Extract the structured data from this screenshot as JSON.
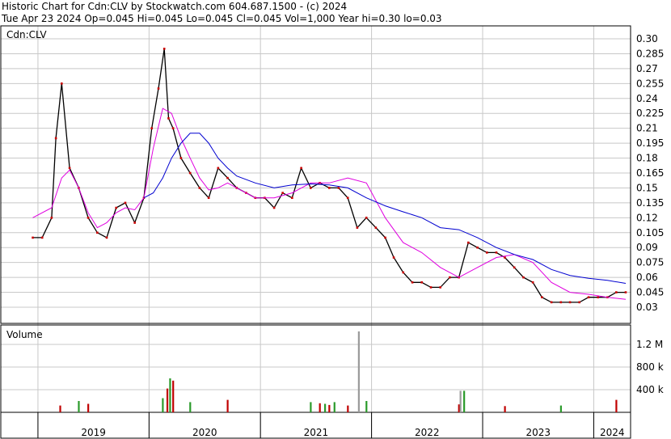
{
  "header": {
    "line1": "Historic Chart for Cdn:CLV by Stockwatch.com 604.687.1500 - (c) 2024",
    "line2": "Tue Apr 23 2024  Op=0.045  Hi=0.045  Lo=0.045  Cl=0.045  Vol=1,000  Year hi=0.30  lo=0.03"
  },
  "chart_data": {
    "type": "line",
    "symbol_label": "Cdn:CLV",
    "volume_label": "Volume",
    "price_ticks": [
      "0.30",
      "0.285",
      "0.27",
      "0.255",
      "0.24",
      "0.225",
      "0.21",
      "0.195",
      "0.18",
      "0.165",
      "0.15",
      "0.135",
      "0.12",
      "0.105",
      "0.09",
      "0.075",
      "0.06",
      "0.045",
      "0.03"
    ],
    "volume_ticks": [
      "1.2 M",
      "800 k",
      "400 k"
    ],
    "year_labels": [
      "2019",
      "2020",
      "2021",
      "2022",
      "2023",
      "2024"
    ],
    "price_range": [
      0.03,
      0.3
    ],
    "volume_range": [
      0,
      1400000
    ],
    "grid": true,
    "series": [
      {
        "name": "price",
        "x": [
          "2018-12-15",
          "2019-01-15",
          "2019-02-15",
          "2019-03-01",
          "2019-03-20",
          "2019-04-15",
          "2019-05-15",
          "2019-06-15",
          "2019-07-15",
          "2019-08-15",
          "2019-09-15",
          "2019-10-15",
          "2019-11-15",
          "2019-12-15",
          "2020-01-10",
          "2020-02-01",
          "2020-02-20",
          "2020-03-05",
          "2020-03-20",
          "2020-04-15",
          "2020-05-15",
          "2020-06-15",
          "2020-07-15",
          "2020-08-15",
          "2020-09-15",
          "2020-10-15",
          "2020-11-15",
          "2020-12-15",
          "2021-01-15",
          "2021-02-15",
          "2021-03-15",
          "2021-04-15",
          "2021-05-15",
          "2021-06-15",
          "2021-07-15",
          "2021-08-15",
          "2021-09-15",
          "2021-10-15",
          "2021-11-15",
          "2021-12-15",
          "2022-01-15",
          "2022-02-15",
          "2022-03-15",
          "2022-04-15",
          "2022-05-15",
          "2022-06-15",
          "2022-07-15",
          "2022-08-15",
          "2022-09-15",
          "2022-10-15",
          "2022-11-15",
          "2022-12-15",
          "2023-01-15",
          "2023-02-15",
          "2023-03-15",
          "2023-04-15",
          "2023-05-15",
          "2023-06-15",
          "2023-07-15",
          "2023-08-15",
          "2023-09-15",
          "2023-10-15",
          "2023-11-15",
          "2023-12-15",
          "2024-01-15",
          "2024-02-15",
          "2024-03-15",
          "2024-04-15"
        ],
        "values": [
          0.1,
          0.1,
          0.12,
          0.2,
          0.255,
          0.17,
          0.15,
          0.12,
          0.105,
          0.1,
          0.13,
          0.135,
          0.115,
          0.14,
          0.21,
          0.25,
          0.29,
          0.22,
          0.21,
          0.18,
          0.165,
          0.15,
          0.14,
          0.17,
          0.16,
          0.15,
          0.145,
          0.14,
          0.14,
          0.13,
          0.145,
          0.14,
          0.17,
          0.15,
          0.155,
          0.15,
          0.15,
          0.14,
          0.11,
          0.12,
          0.11,
          0.1,
          0.08,
          0.065,
          0.055,
          0.055,
          0.05,
          0.05,
          0.06,
          0.06,
          0.095,
          0.09,
          0.085,
          0.085,
          0.08,
          0.07,
          0.06,
          0.055,
          0.04,
          0.035,
          0.035,
          0.035,
          0.035,
          0.04,
          0.04,
          0.04,
          0.045,
          0.045
        ]
      },
      {
        "name": "ma-short",
        "x": [
          "2018-12-15",
          "2019-02-15",
          "2019-03-20",
          "2019-04-15",
          "2019-05-15",
          "2019-06-15",
          "2019-07-15",
          "2019-08-15",
          "2019-09-15",
          "2019-10-15",
          "2019-11-15",
          "2019-12-15",
          "2020-01-15",
          "2020-02-15",
          "2020-03-15",
          "2020-04-15",
          "2020-05-15",
          "2020-06-15",
          "2020-07-15",
          "2020-08-15",
          "2020-09-15",
          "2020-10-15",
          "2020-12-15",
          "2021-02-15",
          "2021-04-15",
          "2021-06-15",
          "2021-08-15",
          "2021-10-15",
          "2021-12-15",
          "2022-02-15",
          "2022-04-15",
          "2022-06-15",
          "2022-08-15",
          "2022-10-15",
          "2022-12-15",
          "2023-02-15",
          "2023-04-15",
          "2023-06-15",
          "2023-08-15",
          "2023-10-15",
          "2023-12-15",
          "2024-02-15",
          "2024-04-15"
        ],
        "values": [
          0.12,
          0.13,
          0.16,
          0.168,
          0.15,
          0.125,
          0.11,
          0.115,
          0.125,
          0.13,
          0.128,
          0.14,
          0.19,
          0.23,
          0.225,
          0.2,
          0.18,
          0.16,
          0.148,
          0.15,
          0.155,
          0.15,
          0.14,
          0.14,
          0.145,
          0.155,
          0.155,
          0.16,
          0.155,
          0.12,
          0.095,
          0.085,
          0.07,
          0.06,
          0.07,
          0.08,
          0.083,
          0.075,
          0.055,
          0.045,
          0.043,
          0.04,
          0.038
        ]
      },
      {
        "name": "ma-long",
        "x": [
          "2019-12-15",
          "2020-01-15",
          "2020-02-15",
          "2020-03-15",
          "2020-04-15",
          "2020-05-15",
          "2020-06-15",
          "2020-07-15",
          "2020-08-15",
          "2020-09-15",
          "2020-10-15",
          "2020-12-15",
          "2021-02-15",
          "2021-04-15",
          "2021-06-15",
          "2021-08-15",
          "2021-10-15",
          "2021-12-15",
          "2022-02-15",
          "2022-04-15",
          "2022-06-15",
          "2022-08-15",
          "2022-10-15",
          "2022-12-15",
          "2023-02-15",
          "2023-04-15",
          "2023-06-15",
          "2023-08-15",
          "2023-10-15",
          "2023-12-15",
          "2024-02-15",
          "2024-04-15"
        ],
        "values": [
          0.14,
          0.145,
          0.16,
          0.18,
          0.195,
          0.205,
          0.205,
          0.195,
          0.18,
          0.17,
          0.162,
          0.155,
          0.15,
          0.153,
          0.154,
          0.153,
          0.15,
          0.14,
          0.132,
          0.126,
          0.12,
          0.11,
          0.108,
          0.1,
          0.09,
          0.083,
          0.078,
          0.068,
          0.062,
          0.059,
          0.057,
          0.054
        ]
      },
      {
        "name": "volume",
        "x": [
          "2019-03-15",
          "2019-05-15",
          "2019-06-15",
          "2020-02-15",
          "2020-03-01",
          "2020-03-10",
          "2020-03-20",
          "2020-05-15",
          "2020-09-15",
          "2021-06-15",
          "2021-07-15",
          "2021-08-01",
          "2021-08-15",
          "2021-09-01",
          "2021-10-15",
          "2021-12-15",
          "2022-10-15",
          "2022-11-01",
          "2023-03-15",
          "2023-09-15",
          "2024-03-15"
        ],
        "values": [
          120000,
          200000,
          150000,
          250000,
          420000,
          600000,
          560000,
          180000,
          220000,
          180000,
          160000,
          150000,
          130000,
          180000,
          120000,
          200000,
          140000,
          380000,
          110000,
          120000,
          220000
        ]
      },
      {
        "name": "volume-grey",
        "x": [
          "2021-11-20",
          "2022-10-20"
        ],
        "values": [
          1430000,
          380000
        ]
      }
    ]
  }
}
